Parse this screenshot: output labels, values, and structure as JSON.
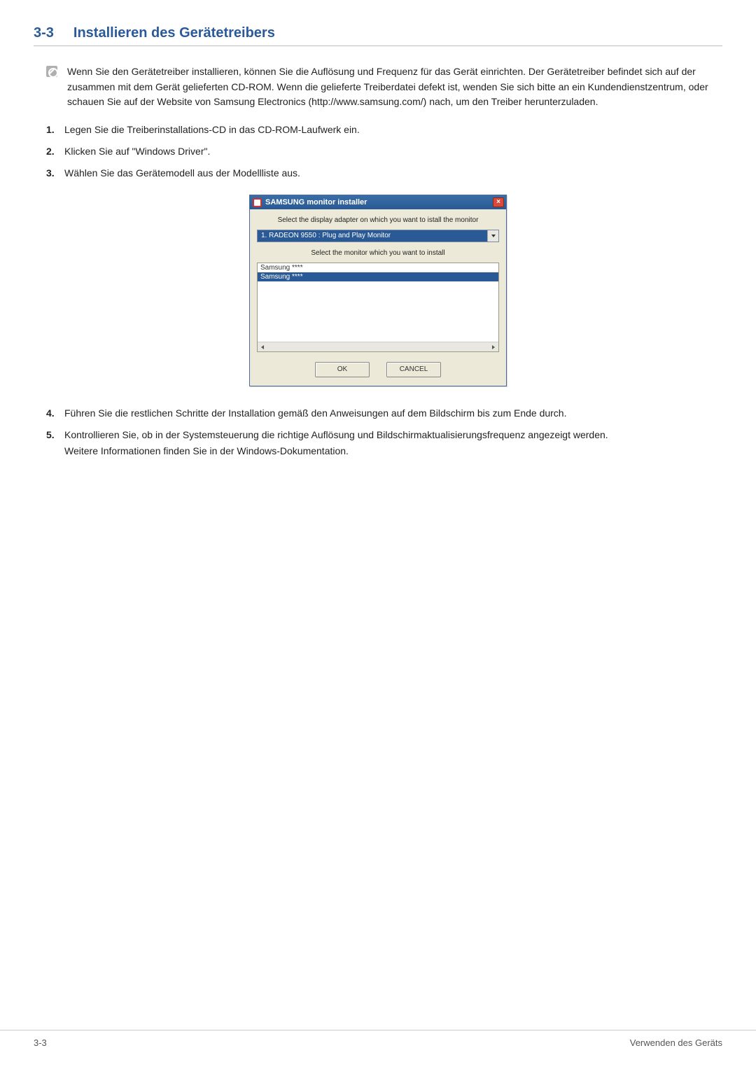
{
  "section": {
    "number": "3-3",
    "title": "Installieren des Gerätetreibers"
  },
  "info_paragraph": "Wenn Sie den Gerätetreiber installieren, können Sie die Auflösung und Frequenz für das Gerät einrichten. Der Gerätetreiber befindet sich auf der zusammen mit dem Gerät gelieferten CD-ROM. Wenn die gelieferte Treiberdatei defekt ist, wenden Sie sich bitte an ein Kundendienstzentrum, oder schauen Sie auf der Website von Samsung Electronics (http://www.samsung.com/) nach, um den Treiber herunterzuladen.",
  "steps": {
    "1": "Legen Sie die Treiberinstallations-CD in das CD-ROM-Laufwerk ein.",
    "2": "Klicken Sie auf \"Windows Driver\".",
    "3": "Wählen Sie das Gerätemodell aus der Modellliste aus.",
    "4": "Führen Sie die restlichen Schritte der Installation gemäß den Anweisungen auf dem Bildschirm bis zum Ende durch.",
    "5": "Kontrollieren Sie, ob in der Systemsteuerung die richtige Auflösung und Bildschirmaktualisierungsfrequenz angezeigt werden.",
    "5_sub": "Weitere Informationen finden Sie in der Windows-Dokumentation."
  },
  "dialog": {
    "title": "SAMSUNG monitor installer",
    "label_adapter": "Select the display adapter on which you want to istall the monitor",
    "combo_value": "1. RADEON 9550 : Plug and Play Monitor",
    "label_monitor": "Select the monitor which you want to install",
    "list_items": [
      "Samsung ****",
      "Samsung ****"
    ],
    "ok": "OK",
    "cancel": "CANCEL",
    "close": "×"
  },
  "footer": {
    "left": "3-3",
    "right": "Verwenden des Geräts"
  }
}
